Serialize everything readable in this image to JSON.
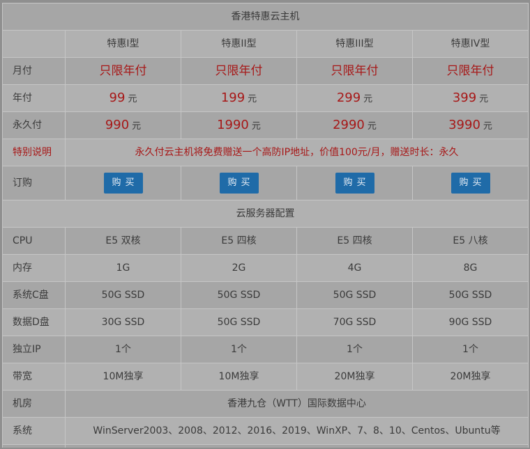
{
  "title": "香港特惠云主机",
  "plans": [
    "特惠I型",
    "特惠II型",
    "特惠III型",
    "特惠IV型"
  ],
  "currency_unit": "元",
  "pricing": {
    "monthly": {
      "label": "月付",
      "values": [
        "只限年付",
        "只限年付",
        "只限年付",
        "只限年付"
      ]
    },
    "yearly": {
      "label": "年付",
      "values": [
        "99",
        "199",
        "299",
        "399"
      ]
    },
    "permanent": {
      "label": "永久付",
      "values": [
        "990",
        "1990",
        "2990",
        "3990"
      ]
    }
  },
  "special": {
    "label": "特别说明",
    "text": "永久付云主机将免费赠送一个高防IP地址，价值100元/月，赠送时长：永久"
  },
  "order": {
    "label": "订购",
    "button_label": "购买"
  },
  "config_title": "云服务器配置",
  "config": {
    "cpu": {
      "label": "CPU",
      "values": [
        "E5 双核",
        "E5 四核",
        "E5 四核",
        "E5 八核"
      ]
    },
    "ram": {
      "label": "内存",
      "values": [
        "1G",
        "2G",
        "4G",
        "8G"
      ]
    },
    "sys_disk": {
      "label": "系统C盘",
      "values": [
        "50G SSD",
        "50G SSD",
        "50G SSD",
        "50G SSD"
      ]
    },
    "data_disk": {
      "label": "数据D盘",
      "values": [
        "30G SSD",
        "50G SSD",
        "70G SSD",
        "90G SSD"
      ]
    },
    "ip": {
      "label": "独立IP",
      "values": [
        "1个",
        "1个",
        "1个",
        "1个"
      ]
    },
    "bandwidth": {
      "label": "带宽",
      "values": [
        "10M独享",
        "10M独享",
        "20M独享",
        "20M独享"
      ]
    }
  },
  "datacenter": {
    "label": "机房",
    "value": "香港九仓（WTT）国际数据中心"
  },
  "os": {
    "label": "系统",
    "value": "WinServer2003、2008、2012、2016、2019、WinXP、7、8、10、Centos、Ubuntu等"
  },
  "colors": {
    "price_red": "#a71818",
    "button_blue": "#1f6ba8",
    "row_dark": "#a6a6a6",
    "row_light": "#b1b1b1",
    "border": "#c6c6c6"
  }
}
